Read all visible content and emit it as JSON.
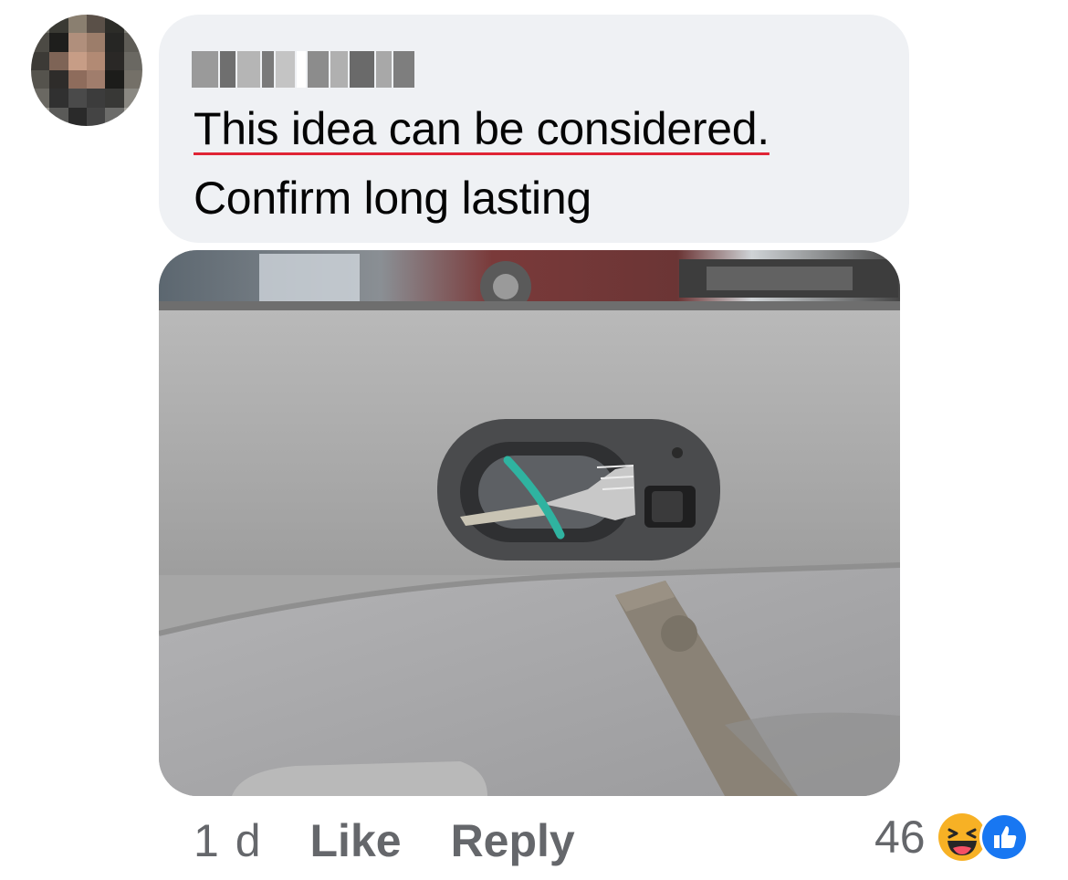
{
  "comment": {
    "author_name_redacted": "",
    "text_line1": "This idea can be considered.",
    "text_line2": "Confirm long lasting",
    "image_alt": "Car door interior with a fork tied by a green rubber band in place of the door handle"
  },
  "footer": {
    "timestamp": "1 d",
    "like_label": "Like",
    "reply_label": "Reply"
  },
  "reactions": {
    "count": "46",
    "icons": [
      "haha-icon",
      "like-icon"
    ]
  },
  "colors": {
    "bubble": "#eff1f4",
    "text": "#050505",
    "secondary": "#65676b",
    "spellcheck": "#e02435",
    "like_blue": "#1877f2",
    "haha_yellow": "#f7b125"
  }
}
